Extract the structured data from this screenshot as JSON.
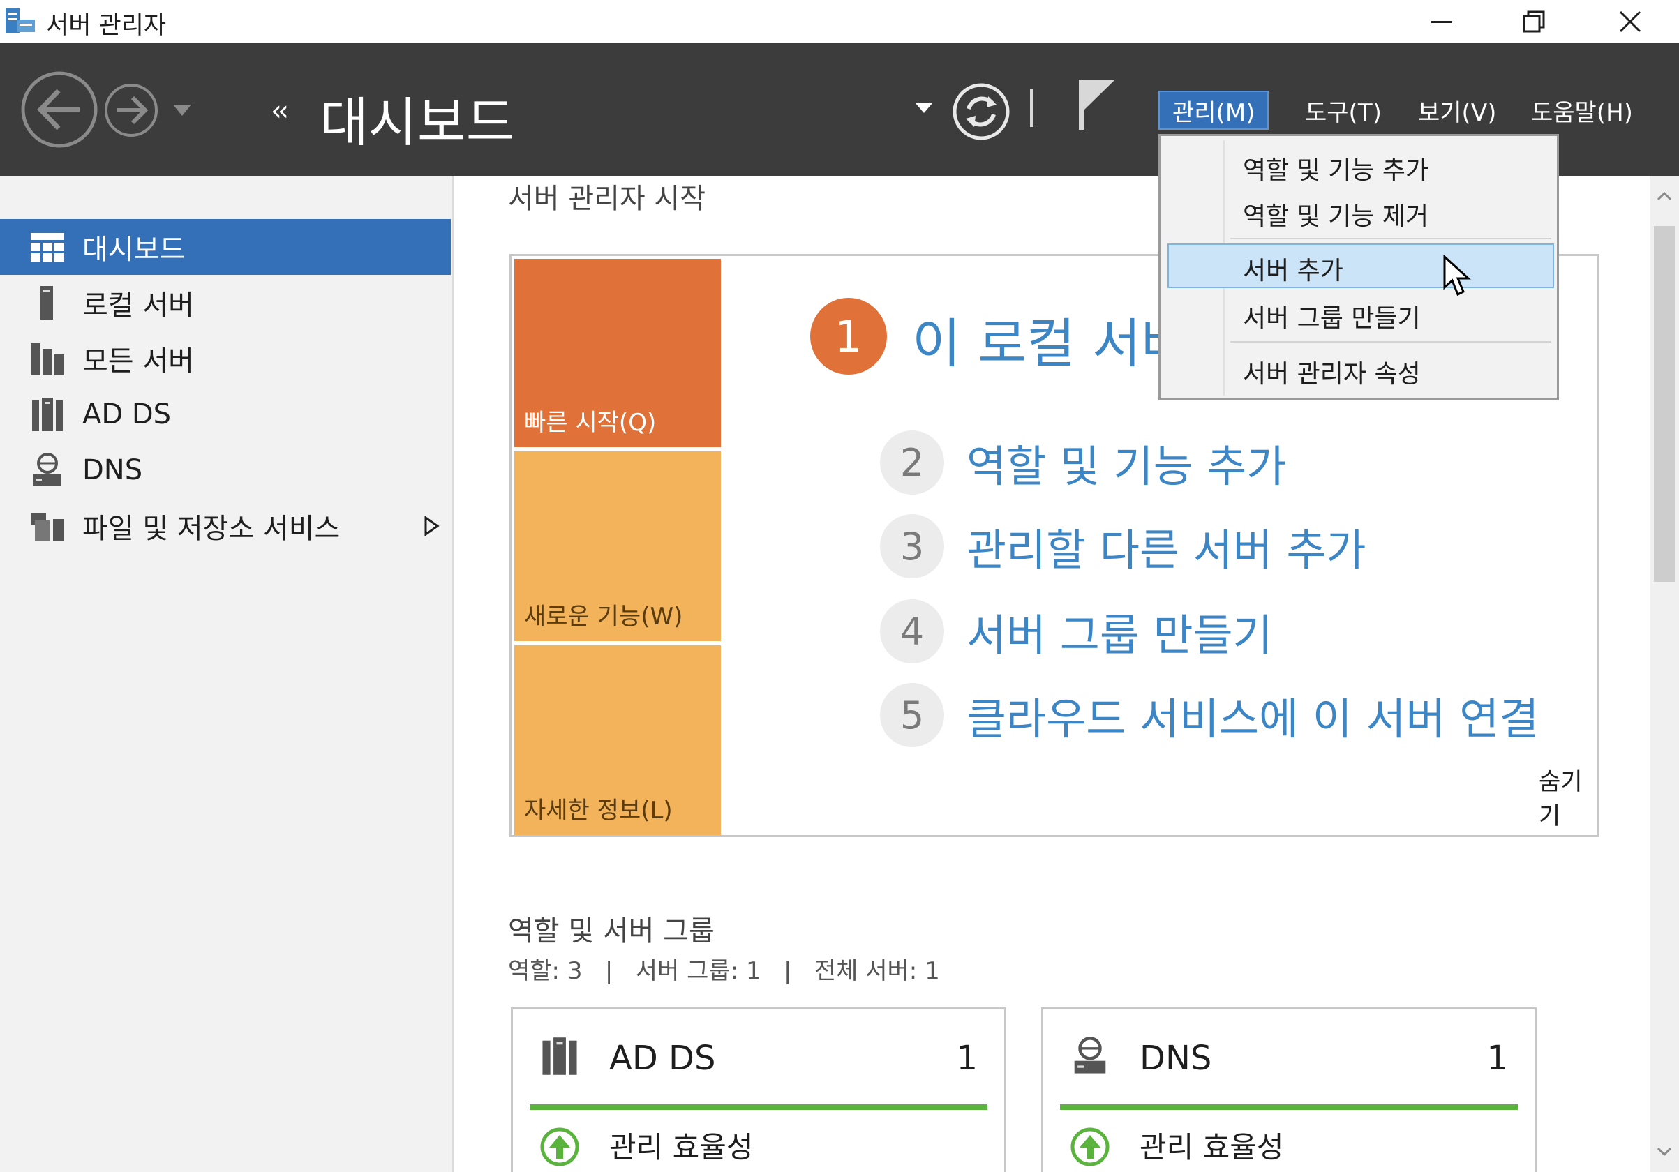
{
  "window": {
    "title": "서버 관리자",
    "icons": {
      "app": "server-manager-icon",
      "minimize": "minimize-icon",
      "maximize": "restore-icon",
      "close": "close-icon"
    }
  },
  "header": {
    "breadcrumb_arrows": "‹‹",
    "title": "대시보드",
    "menus": [
      {
        "label": "관리(M)",
        "active": true
      },
      {
        "label": "도구(T)"
      },
      {
        "label": "보기(V)"
      },
      {
        "label": "도움말(H)"
      }
    ],
    "icons": {
      "back": "back-arrow-icon",
      "forward": "forward-arrow-icon",
      "refresh": "refresh-icon",
      "flag": "notification-flag-icon"
    }
  },
  "manage_menu": {
    "items": [
      {
        "label": "역할 및 기능 추가"
      },
      {
        "label": "역할 및 기능 제거"
      },
      {
        "label": "서버 추가",
        "hovered": true
      },
      {
        "label": "서버 그룹 만들기"
      },
      {
        "label": "서버 관리자 속성"
      }
    ]
  },
  "sidebar": {
    "items": [
      {
        "label": "대시보드",
        "icon": "dashboard-grid-icon",
        "active": true
      },
      {
        "label": "로컬 서버",
        "icon": "local-server-icon"
      },
      {
        "label": "모든 서버",
        "icon": "all-servers-icon"
      },
      {
        "label": "AD DS",
        "icon": "ad-ds-icon"
      },
      {
        "label": "DNS",
        "icon": "dns-icon"
      },
      {
        "label": "파일 및 저장소 서비스",
        "icon": "file-storage-icon",
        "has_submenu": true
      }
    ]
  },
  "welcome": {
    "section_title": "서버 관리자 시작",
    "tiles": [
      {
        "label": "빠른 시작(Q)",
        "color": "#e07138"
      },
      {
        "label": "새로운 기능(W)",
        "color": "#f2b35a"
      },
      {
        "label": "자세한 정보(L)",
        "color": "#f2b35a"
      }
    ],
    "step1": {
      "number": "1",
      "label": "이 로컬 서버 구성"
    },
    "steps": [
      {
        "number": "2",
        "label": "역할 및 기능 추가"
      },
      {
        "number": "3",
        "label": "관리할 다른 서버 추가"
      },
      {
        "number": "4",
        "label": "서버 그룹 만들기"
      },
      {
        "number": "5",
        "label": "클라우드 서비스에 이 서버 연결"
      }
    ],
    "hide_link": "숨기기"
  },
  "roles": {
    "title": "역할 및 서버 그룹",
    "summary": "역할: 3   |   서버 그룹: 1   |   전체 서버: 1",
    "cards": [
      {
        "name": "AD DS",
        "count": "1",
        "icon": "ad-ds-icon",
        "status": "관리 효율성",
        "status_icon": "up-arrow-circle-icon",
        "status_color": "#59b33c"
      },
      {
        "name": "DNS",
        "count": "1",
        "icon": "dns-icon",
        "status": "관리 효율성",
        "status_icon": "up-arrow-circle-icon",
        "status_color": "#59b33c"
      }
    ]
  }
}
